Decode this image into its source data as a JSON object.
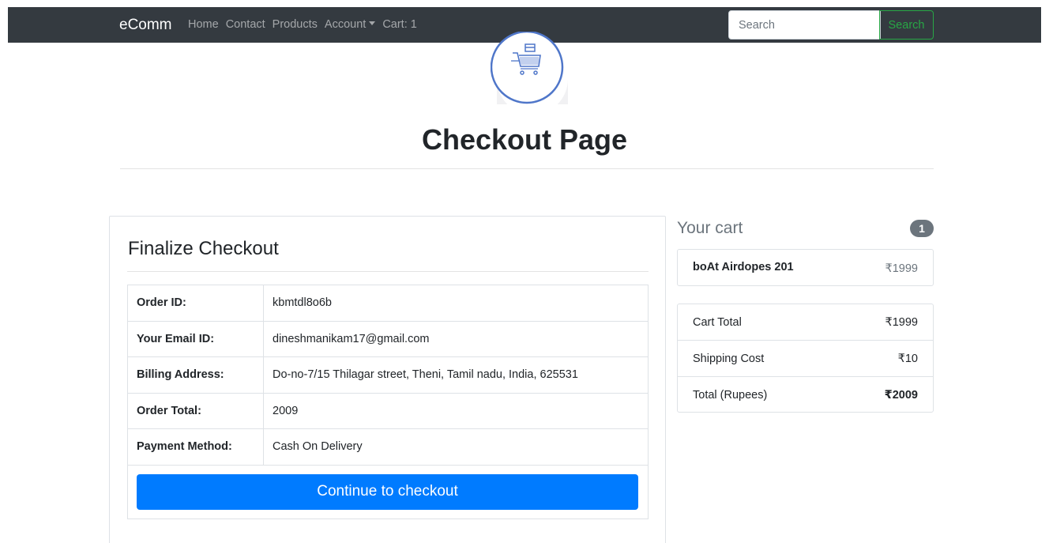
{
  "navbar": {
    "brand": "eComm",
    "links": [
      "Home",
      "Contact",
      "Products",
      "Account",
      "Cart: 1"
    ],
    "search_placeholder": "Search",
    "search_button": "Search"
  },
  "page_title": "Checkout Page",
  "checkout": {
    "title": "Finalize Checkout",
    "rows": [
      {
        "label": "Order ID:",
        "value": "kbmtdl8o6b"
      },
      {
        "label": "Your Email ID:",
        "value": "dineshmanikam17@gmail.com"
      },
      {
        "label": "Billing Address:",
        "value": "Do-no-7/15 Thilagar street, Theni, Tamil nadu, India, 625531"
      },
      {
        "label": "Order Total:",
        "value": "2009"
      },
      {
        "label": "Payment Method:",
        "value": "Cash On Delivery"
      }
    ],
    "continue_button": "Continue to checkout"
  },
  "cart": {
    "heading": "Your cart",
    "count": "1",
    "items": [
      {
        "name": "boAt Airdopes 201",
        "price": "₹1999"
      }
    ],
    "totals": [
      {
        "label": "Cart Total",
        "value": "₹1999"
      },
      {
        "label": "Shipping Cost",
        "value": "₹10"
      },
      {
        "label": "Total (Rupees)",
        "value": "₹2009"
      }
    ]
  },
  "colors": {
    "navbar": "#343a40",
    "primary": "#007bff",
    "success": "#28a745",
    "muted": "#6c757d"
  },
  "icons": {
    "logo": "shopping-cart-icon"
  }
}
